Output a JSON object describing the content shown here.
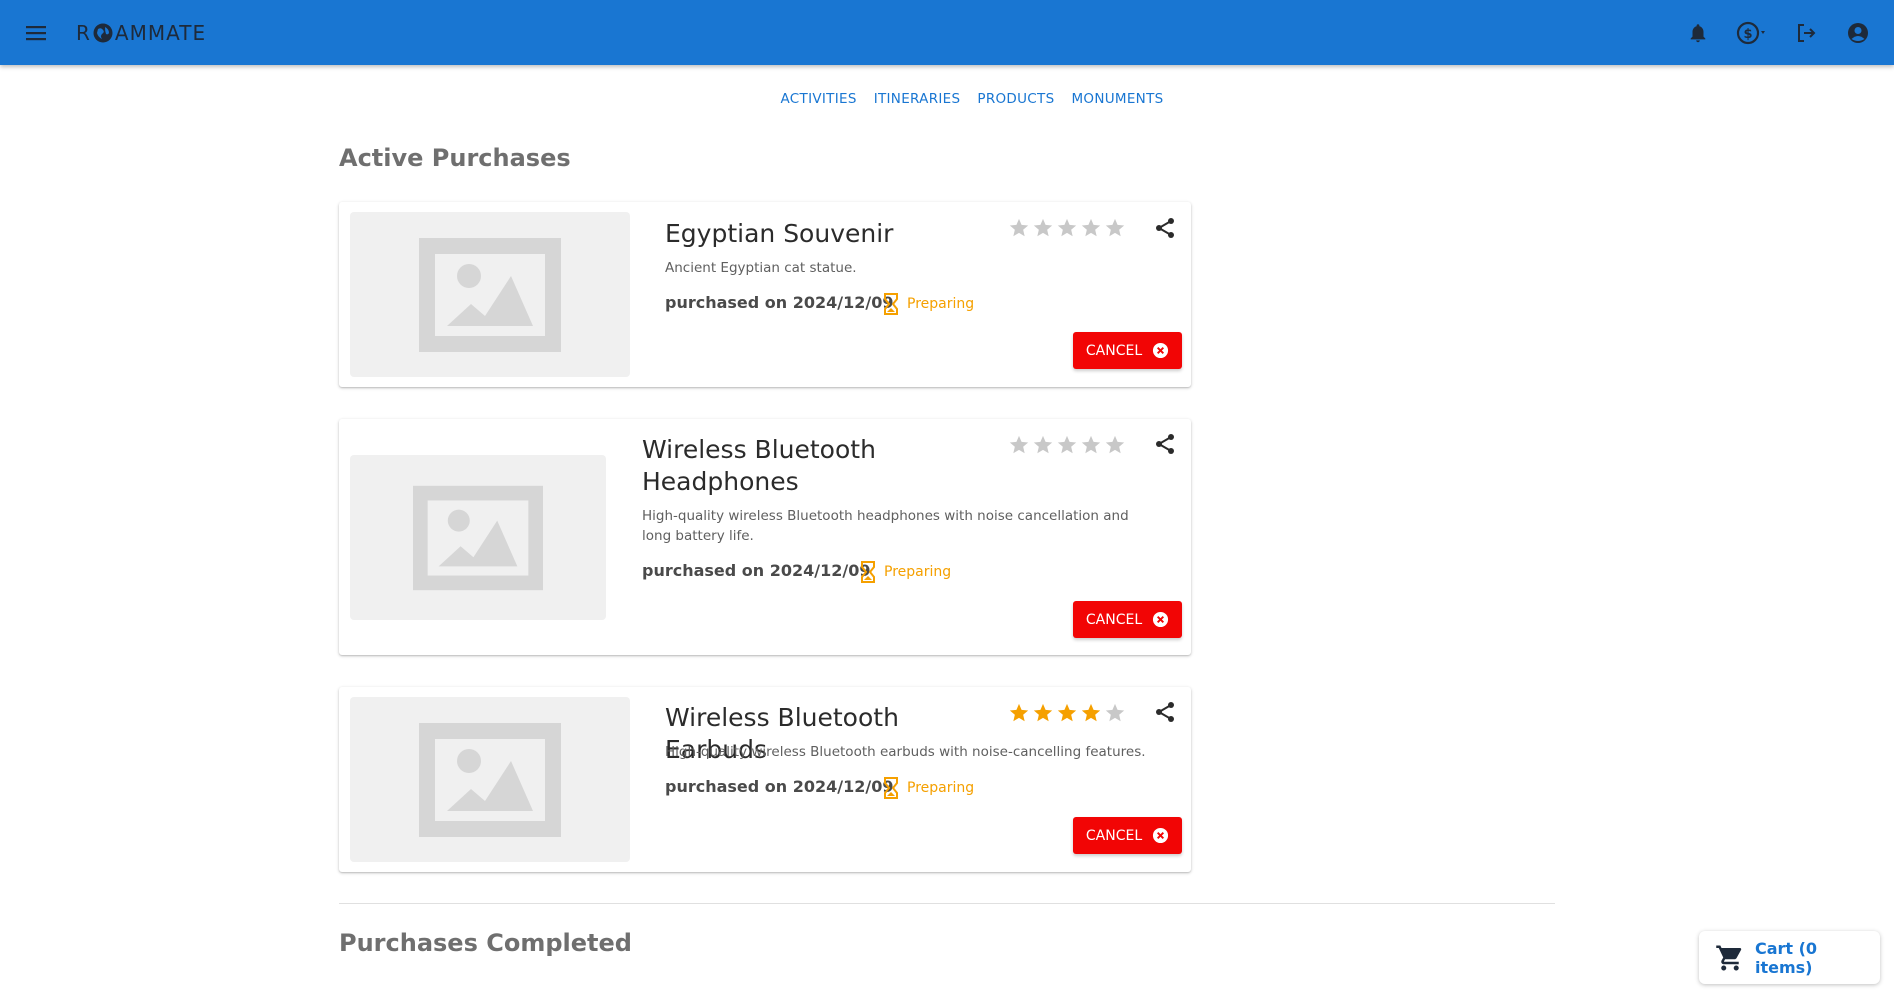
{
  "app": {
    "logo_text_pre": "R",
    "logo_text_post": "AMMATE"
  },
  "nav": [
    "ACTIVITIES",
    "ITINERARIES",
    "PRODUCTS",
    "MONUMENTS"
  ],
  "sections": {
    "active": "Active Purchases",
    "completed": "Purchases Completed"
  },
  "purchases": [
    {
      "name": "Egyptian Souvenir",
      "description": "Ancient Egyptian cat statue.",
      "purchased": "purchased on 2024/12/09",
      "status": "Preparing",
      "rating": 0,
      "cancel_label": "CANCEL"
    },
    {
      "name": "Wireless Bluetooth Headphones",
      "description": "High-quality wireless Bluetooth headphones with noise cancellation and long battery life.",
      "purchased": "purchased on 2024/12/09",
      "status": "Preparing",
      "rating": 0,
      "cancel_label": "CANCEL"
    },
    {
      "name": "Wireless Bluetooth Earbuds",
      "description": "High-quality wireless Bluetooth earbuds with noise-cancelling features.",
      "purchased": "purchased on 2024/12/09",
      "status": "Preparing",
      "rating": 4,
      "cancel_label": "CANCEL"
    }
  ],
  "cart": {
    "label": "Cart (0 items)"
  },
  "colors": {
    "primary": "#1976d2",
    "danger": "#f20505",
    "status": "#f5a000",
    "star_on": "#f5a000",
    "star_off": "#c8c8c8"
  },
  "icons": [
    "menu-icon",
    "globe-icon",
    "bell-icon",
    "currency-exchange-icon",
    "logout-icon",
    "account-icon",
    "image-placeholder-icon",
    "star-icon",
    "share-icon",
    "hourglass-icon",
    "cancel-circle-icon",
    "cart-icon"
  ]
}
